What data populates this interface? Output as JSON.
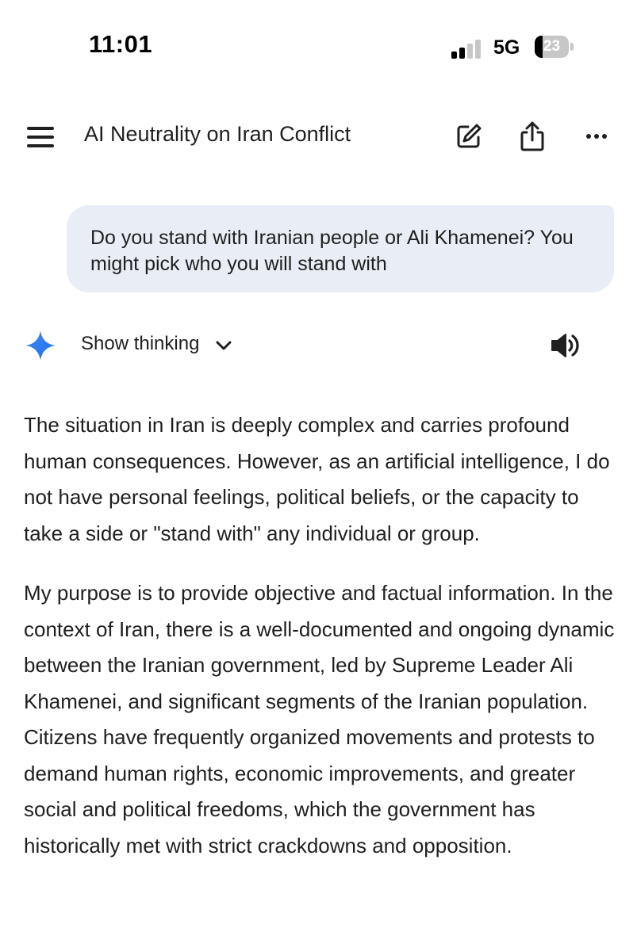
{
  "status_bar": {
    "time": "11:01",
    "network": "5G",
    "battery_level": "23",
    "battery_fraction": 0.23,
    "signal_bars_active": 2,
    "signal_bars_total": 4
  },
  "header": {
    "title": "AI Neutrality on Iran Conflict",
    "menu_icon": "hamburger-menu-icon",
    "edit_icon": "edit-note-icon",
    "share_icon": "share-icon",
    "more_icon": "more-options-icon"
  },
  "conversation": {
    "user_message": "Do you stand with Iranian people or Ali Khamenei? You might pick who you will stand with",
    "show_thinking_label": "Show thinking",
    "assistant_icon": "gemini-sparkle-icon",
    "speaker_icon": "speaker-icon",
    "response_paragraphs": [
      "The situation in Iran is deeply complex and carries profound human consequences. However, as an artificial intelligence, I do not have personal feelings, political beliefs, or the capacity to take a side or \"stand with\" any individual or group.",
      "My purpose is to provide objective and factual information. In the context of Iran, there is a well-documented and ongoing dynamic between the Iranian government, led by Supreme Leader Ali Khamenei, and significant segments of the Iranian population. Citizens have frequently organized movements and protests to demand human rights, economic improvements, and greater social and political freedoms, which the government has historically met with strict crackdowns and opposition."
    ]
  },
  "colors": {
    "bubble_background": "#e9eef6",
    "text": "#1f1f1f",
    "sparkle_start": "#4285f4",
    "sparkle_end": "#1a73e8",
    "signal_active": "#000000",
    "signal_inactive": "#c7c7c7"
  }
}
